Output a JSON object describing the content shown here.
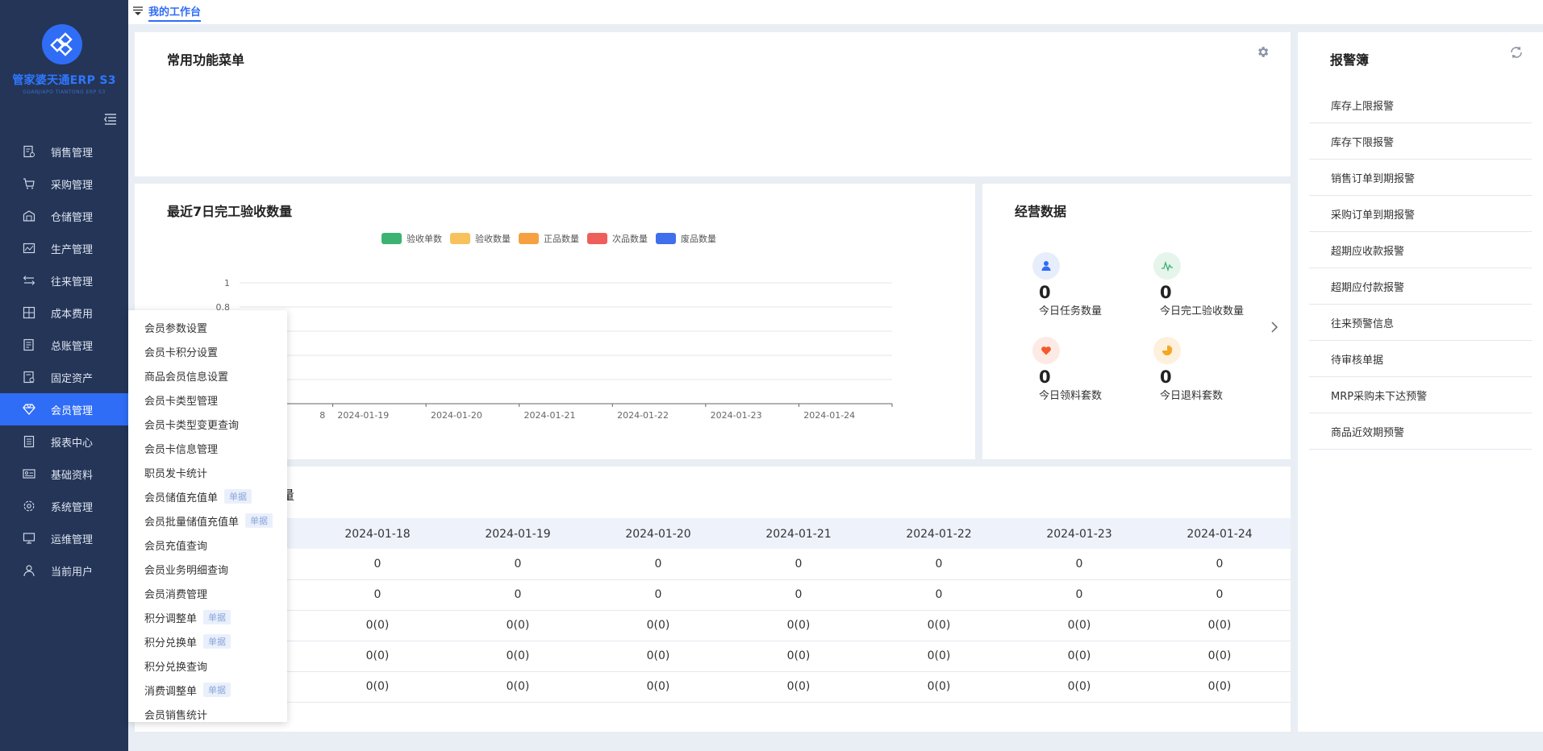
{
  "app": {
    "name": "管家婆天通ERP S3",
    "subtitle": "GUANJIAPO TIANTONG ERP S3"
  },
  "topbar": {
    "tab_label": "我的工作台"
  },
  "sidebar": {
    "items": [
      {
        "label": "销售管理",
        "icon": "sales-icon"
      },
      {
        "label": "采购管理",
        "icon": "cart-icon"
      },
      {
        "label": "仓储管理",
        "icon": "warehouse-icon"
      },
      {
        "label": "生产管理",
        "icon": "factory-icon"
      },
      {
        "label": "往来管理",
        "icon": "exchange-icon"
      },
      {
        "label": "成本费用",
        "icon": "calculator-icon"
      },
      {
        "label": "总账管理",
        "icon": "ledger-icon"
      },
      {
        "label": "固定资产",
        "icon": "asset-icon"
      },
      {
        "label": "会员管理",
        "icon": "diamond-icon",
        "active": true
      },
      {
        "label": "报表中心",
        "icon": "report-icon"
      },
      {
        "label": "基础资料",
        "icon": "id-card-icon"
      },
      {
        "label": "系统管理",
        "icon": "gear-icon"
      },
      {
        "label": "运维管理",
        "icon": "monitor-icon"
      },
      {
        "label": "当前用户",
        "icon": "user-icon"
      }
    ]
  },
  "member_menu": {
    "items": [
      {
        "label": "会员参数设置"
      },
      {
        "label": "会员卡积分设置"
      },
      {
        "label": "商品会员信息设置"
      },
      {
        "label": "会员卡类型管理"
      },
      {
        "label": "会员卡类型变更查询"
      },
      {
        "label": "会员卡信息管理"
      },
      {
        "label": "职员发卡统计"
      },
      {
        "label": "会员储值充值单",
        "badge": "单据"
      },
      {
        "label": "会员批量储值充值单",
        "badge": "单据"
      },
      {
        "label": "会员充值查询"
      },
      {
        "label": "会员业务明细查询"
      },
      {
        "label": "会员消费管理"
      },
      {
        "label": "积分调整单",
        "badge": "单据"
      },
      {
        "label": "积分兑换单",
        "badge": "单据"
      },
      {
        "label": "积分兑换查询"
      },
      {
        "label": "消费调整单",
        "badge": "单据"
      },
      {
        "label": "会员销售统计"
      }
    ]
  },
  "common_menu": {
    "title": "常用功能菜单"
  },
  "chart_panel": {
    "title": "最近7日完工验收数量"
  },
  "chart_data": {
    "type": "line",
    "categories": [
      "2024-01-18",
      "2024-01-19",
      "2024-01-20",
      "2024-01-21",
      "2024-01-22",
      "2024-01-23",
      "2024-01-24"
    ],
    "x_tick_labels": [
      "8",
      "2024-01-19",
      "2024-01-20",
      "2024-01-21",
      "2024-01-22",
      "2024-01-23",
      "2024-01-24"
    ],
    "series": [
      {
        "name": "验收单数",
        "color": "#3cb371",
        "values": [
          0,
          0,
          0,
          0,
          0,
          0,
          0
        ]
      },
      {
        "name": "验收数量",
        "color": "#f7c15c",
        "values": [
          0,
          0,
          0,
          0,
          0,
          0,
          0
        ]
      },
      {
        "name": "正品数量",
        "color": "#f5a142",
        "values": [
          0,
          0,
          0,
          0,
          0,
          0,
          0
        ]
      },
      {
        "name": "次品数量",
        "color": "#ee5f5b",
        "values": [
          0,
          0,
          0,
          0,
          0,
          0,
          0
        ]
      },
      {
        "name": "废品数量",
        "color": "#3f6fed",
        "values": [
          0,
          0,
          0,
          0,
          0,
          0,
          0
        ]
      }
    ],
    "y_tick_labels": [
      "1",
      "0.8"
    ],
    "ylim": [
      0,
      1
    ],
    "grid": true,
    "legend": "top-center"
  },
  "biz_panel": {
    "title": "经营数据",
    "stats": [
      {
        "value": "0",
        "label": "今日任务数量",
        "icon": "person-icon",
        "color": "#2f6df6",
        "bg": "#e6eefc"
      },
      {
        "value": "0",
        "label": "今日完工验收数量",
        "icon": "pulse-icon",
        "color": "#3cb371",
        "bg": "#e6f5ec"
      },
      {
        "value": "0",
        "label": "今日领料套数",
        "icon": "heart-icon",
        "color": "#f25a2c",
        "bg": "#fdeae4"
      },
      {
        "value": "0",
        "label": "今日退料套数",
        "icon": "pie-icon",
        "color": "#f5a623",
        "bg": "#fdf1dd"
      }
    ]
  },
  "table_panel": {
    "title_tail": "量",
    "columns": [
      "2024-01-18",
      "2024-01-19",
      "2024-01-20",
      "2024-01-21",
      "2024-01-22",
      "2024-01-23",
      "2024-01-24"
    ],
    "rows": [
      [
        "0",
        "0",
        "0",
        "0",
        "0",
        "0",
        "0"
      ],
      [
        "0",
        "0",
        "0",
        "0",
        "0",
        "0",
        "0"
      ],
      [
        "0(0)",
        "0(0)",
        "0(0)",
        "0(0)",
        "0(0)",
        "0(0)",
        "0(0)"
      ],
      [
        "0(0)",
        "0(0)",
        "0(0)",
        "0(0)",
        "0(0)",
        "0(0)",
        "0(0)"
      ],
      [
        "0(0)",
        "0(0)",
        "0(0)",
        "0(0)",
        "0(0)",
        "0(0)",
        "0(0)"
      ]
    ]
  },
  "alert_panel": {
    "title": "报警簿",
    "items": [
      "库存上限报警",
      "库存下限报警",
      "销售订单到期报警",
      "采购订单到期报警",
      "超期应收款报警",
      "超期应付款报警",
      "往来预警信息",
      "待审核单据",
      "MRP采购未下达预警",
      "商品近效期预警"
    ]
  }
}
